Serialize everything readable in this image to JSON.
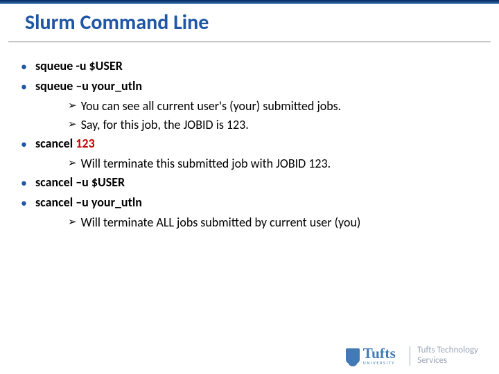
{
  "title": "Slurm Command Line",
  "bullets": {
    "b1": "squeue -u $USER",
    "b2": "squeue –u your_utln",
    "b2s1": "You can see all current user's (your) submitted jobs.",
    "b2s2": "Say, for this job, the JOBID is 123.",
    "b3a": "scancel ",
    "b3b": "123",
    "b3s1": "Will terminate this submitted job with JOBID 123.",
    "b4": "scancel –u $USER",
    "b5": "scancel –u your_utln",
    "b5s1": "Will terminate ALL jobs submitted by current user (you)"
  },
  "footer": {
    "logo_main": "Tufts",
    "logo_sub": "UNIVERSITY",
    "tts_l1": "Tufts Technology",
    "tts_l2": "Services"
  }
}
